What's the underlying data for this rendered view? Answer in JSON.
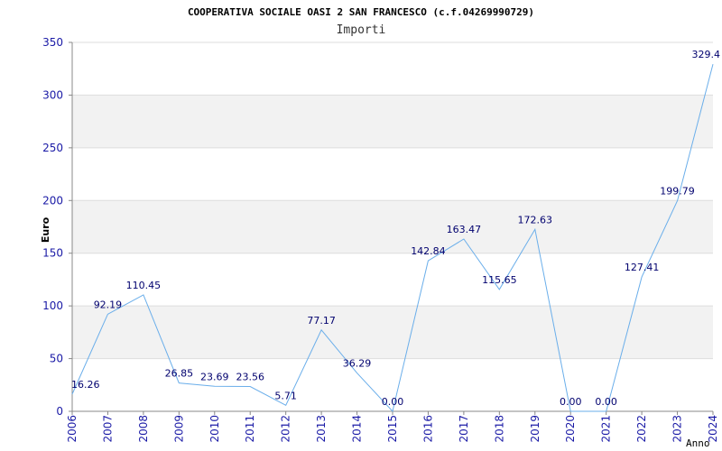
{
  "chart_data": {
    "type": "line",
    "title": "COOPERATIVA SOCIALE OASI 2 SAN FRANCESCO (c.f.04269990729)",
    "subtitle": "Importi",
    "xlabel": "Anno",
    "ylabel": "Euro",
    "ylim": [
      0,
      350
    ],
    "yticks": [
      0,
      50,
      100,
      150,
      200,
      250,
      300,
      350
    ],
    "grid": true,
    "categories": [
      "2006",
      "2007",
      "2008",
      "2009",
      "2010",
      "2011",
      "2012",
      "2013",
      "2014",
      "2015",
      "2016",
      "2017",
      "2018",
      "2019",
      "2020",
      "2021",
      "2022",
      "2023",
      "2024"
    ],
    "values": [
      16.26,
      92.19,
      110.45,
      26.85,
      23.69,
      23.56,
      5.71,
      77.17,
      36.29,
      0.0,
      142.84,
      163.47,
      115.65,
      172.63,
      0.0,
      0.0,
      127.41,
      199.79,
      329.4
    ],
    "data_labels": [
      "16.26",
      "92.19",
      "110.45",
      "26.85",
      "23.69",
      "23.56",
      "5.71",
      "77.17",
      "36.29",
      "0.00",
      "142.84",
      "163.47",
      "115.65",
      "172.63",
      "0.00",
      "0.00",
      "127.41",
      "199.79",
      "329.4"
    ],
    "colors": {
      "line": "#6aaeea",
      "band": "#f2f2f2",
      "gridline": "#dddddd",
      "tick_text": "#1a1aa6",
      "data_label": "#00006e",
      "title_text": "#000000",
      "subtitle_text": "#333333",
      "axis": "#888888"
    }
  }
}
